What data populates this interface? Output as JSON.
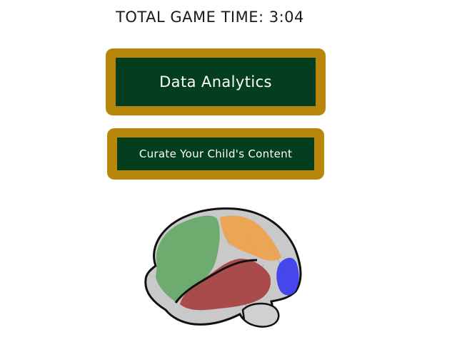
{
  "header": {
    "game_time_label": "TOTAL GAME TIME:",
    "game_time_value": "3:04"
  },
  "menu": {
    "analytics_label": "Data Analytics",
    "curate_label": "Curate Your Child's Content"
  },
  "colors": {
    "board_frame": "#b8860b",
    "board_slate": "#033f1f",
    "frontal_lobe": "#66a866",
    "parietal_lobe": "#f0a048",
    "temporal_lobe": "#a84444",
    "occipital_lobe": "#3b3bf0",
    "brain_base": "#c9c9c9"
  },
  "brain_image": {
    "icon": "brain-icon"
  }
}
